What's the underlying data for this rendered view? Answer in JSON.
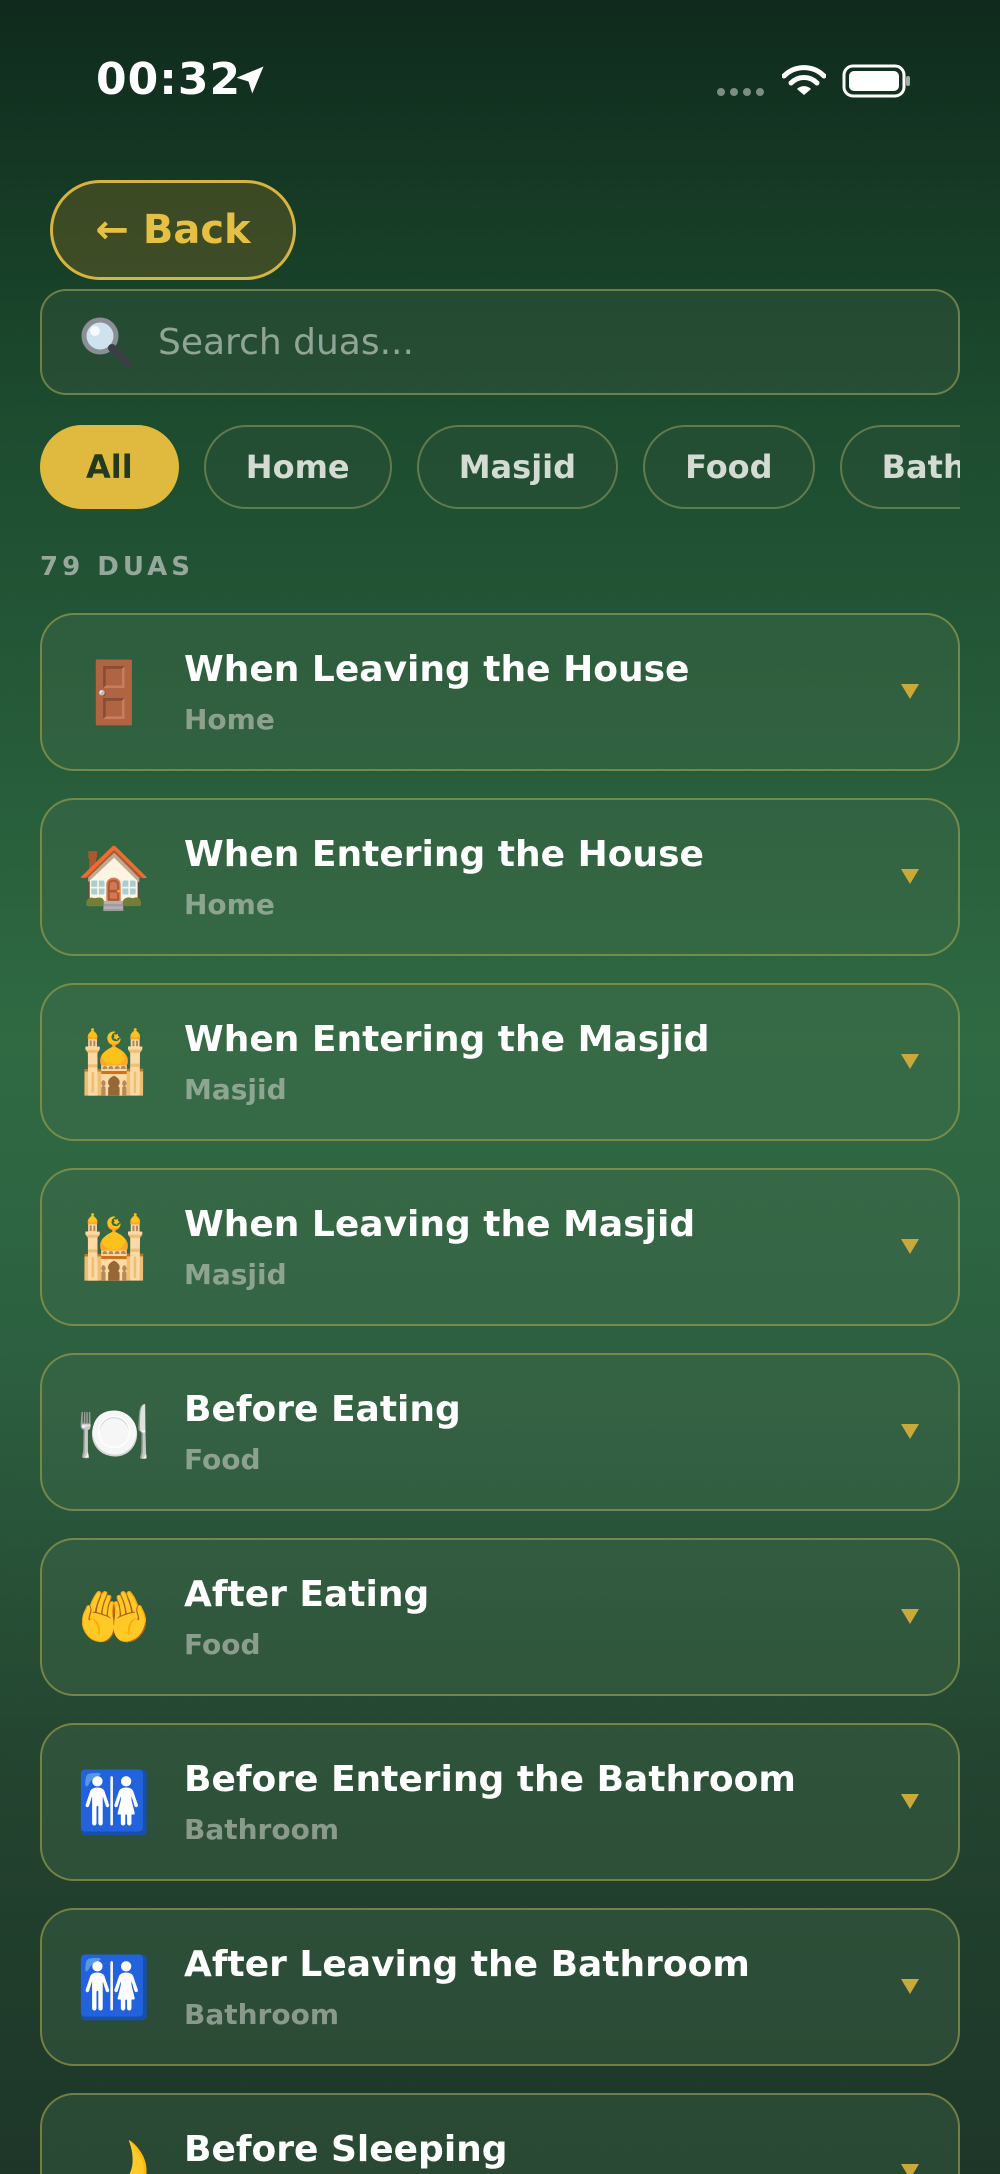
{
  "status_bar": {
    "time": "00:32",
    "icons": [
      "location-arrow-icon",
      "signal-icon",
      "wifi-icon",
      "battery-icon"
    ]
  },
  "header": {
    "back_label": "Back",
    "back_icon": "arrow-left-icon"
  },
  "search": {
    "placeholder": "Search duas...",
    "value": "",
    "icon": "magnifying-glass-icon"
  },
  "filters": {
    "items": [
      {
        "label": "All",
        "active": true
      },
      {
        "label": "Home",
        "active": false
      },
      {
        "label": "Masjid",
        "active": false
      },
      {
        "label": "Food",
        "active": false
      },
      {
        "label": "Bathroom",
        "active": false
      }
    ]
  },
  "count_label": "79 DUAS",
  "duas": [
    {
      "emoji": "🚪",
      "icon": "door-icon",
      "title": "When Leaving the House",
      "category": "Home"
    },
    {
      "emoji": "🏠",
      "icon": "house-icon",
      "title": "When Entering the House",
      "category": "Home"
    },
    {
      "emoji": "🕌",
      "icon": "mosque-icon",
      "title": "When Entering the Masjid",
      "category": "Masjid"
    },
    {
      "emoji": "🕌",
      "icon": "mosque-icon",
      "title": "When Leaving the Masjid",
      "category": "Masjid"
    },
    {
      "emoji": "🍽️",
      "icon": "plate-cutlery-icon",
      "title": "Before Eating",
      "category": "Food"
    },
    {
      "emoji": "🤲",
      "icon": "open-hands-icon",
      "title": "After Eating",
      "category": "Food"
    },
    {
      "emoji": "🚻",
      "icon": "restroom-icon",
      "title": "Before Entering the Bathroom",
      "category": "Bathroom"
    },
    {
      "emoji": "🚻",
      "icon": "restroom-icon",
      "title": "After Leaving the Bathroom",
      "category": "Bathroom"
    },
    {
      "emoji": "🌙",
      "icon": "crescent-moon-icon",
      "title": "Before Sleeping",
      "category": ""
    }
  ],
  "colors": {
    "accent": "#dfba3e",
    "chevron": "#c9a93a"
  }
}
